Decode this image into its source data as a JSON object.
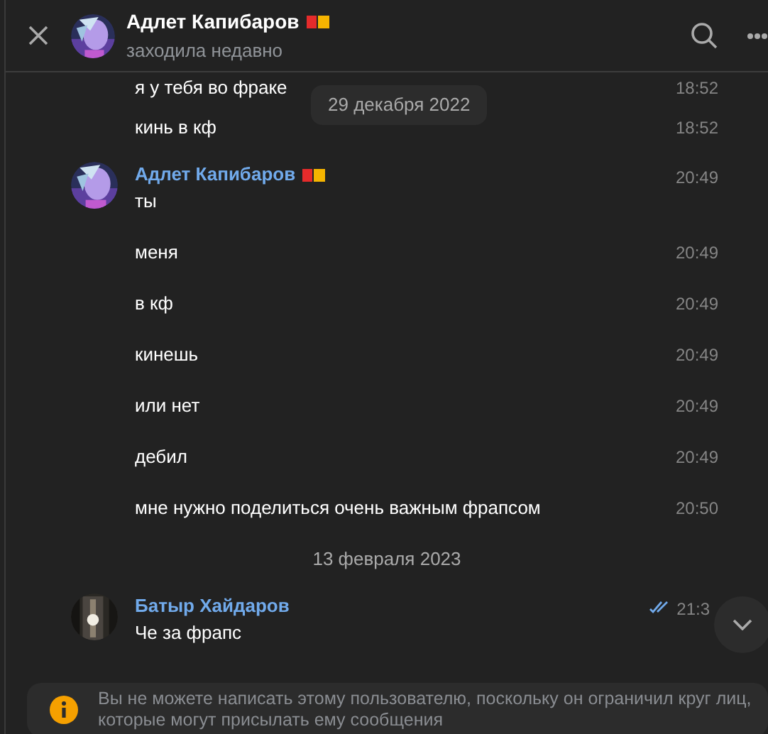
{
  "header": {
    "title": "Адлет Капибаров",
    "status": "заходила недавно"
  },
  "floating_date": "29 декабря 2022",
  "feed": [
    {
      "kind": "plain",
      "text": "я у тебя во фраке",
      "time": "18:52"
    },
    {
      "kind": "plain",
      "text": "кинь в кф",
      "time": "18:52"
    },
    {
      "kind": "head",
      "author": "Адлет Капибаров",
      "badge": true,
      "text": "ты",
      "time": "20:49"
    },
    {
      "kind": "plain",
      "text": "меня",
      "time": "20:49"
    },
    {
      "kind": "plain",
      "text": "в кф",
      "time": "20:49"
    },
    {
      "kind": "plain",
      "text": "кинешь",
      "time": "20:49"
    },
    {
      "kind": "plain",
      "text": "или нет",
      "time": "20:49"
    },
    {
      "kind": "plain",
      "text": "дебил",
      "time": "20:49"
    },
    {
      "kind": "plain",
      "text": "мне нужно поделиться очень важным фрапсом",
      "time": "20:50"
    },
    {
      "kind": "date",
      "text": "13 февраля 2023"
    },
    {
      "kind": "head",
      "author": "Батыр Хайдаров",
      "badge": false,
      "read": true,
      "text": "Че за фрапс",
      "time": "21:3"
    }
  ],
  "notice": "Вы не можете написать этому пользователю, поскольку он ограничил круг лиц, которые могут присылать ему сообщения"
}
